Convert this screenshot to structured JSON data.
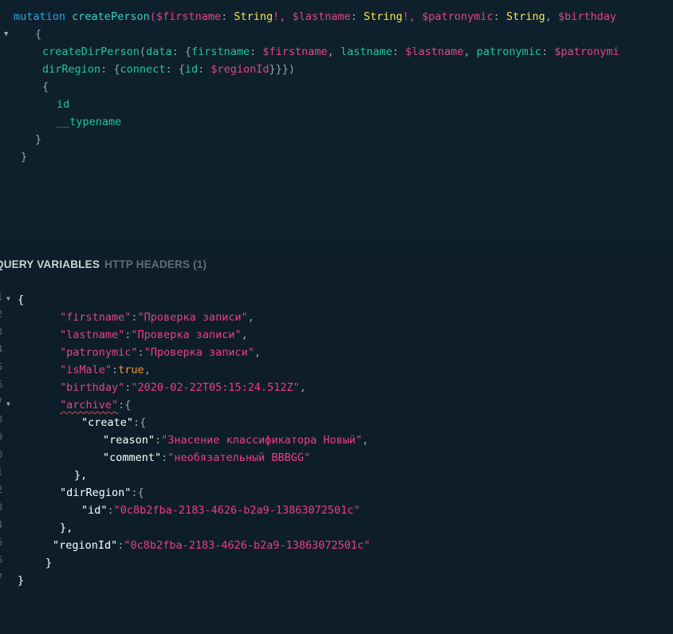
{
  "query_editor": {
    "lines": [
      [
        "mutation",
        "createPerson",
        "($firstname",
        ": ",
        "String",
        "!, ",
        "$lastname",
        ": ",
        "String",
        "!, ",
        "$patronymic",
        ": ",
        "String",
        ", ",
        "$birthday"
      ],
      [
        "{"
      ],
      [
        "createDirPerson",
        "(",
        "data",
        ": {",
        "firstname",
        ": ",
        "$firstname",
        ", ",
        "lastname",
        ": ",
        "$lastname",
        ", ",
        "patronymic",
        ": ",
        "$patronymi"
      ],
      [
        "dirRegion",
        ": {",
        "connect",
        ": {",
        "id",
        ": ",
        "$regionId",
        "}}})"
      ],
      [
        "{"
      ],
      [
        "id"
      ],
      [
        "__typename"
      ],
      [
        "}"
      ],
      [
        "}"
      ]
    ]
  },
  "tabs": {
    "query_variables": "QUERY VARIABLES",
    "http_headers": "HTTP HEADERS (1)"
  },
  "variables_editor": {
    "gutter": [
      "1",
      "2",
      "3",
      "4",
      "5",
      "6",
      "7",
      "8",
      "9",
      "0",
      "1",
      "2",
      "3",
      "4",
      "5",
      "6",
      "7"
    ],
    "firstname_key": "\"firstname\"",
    "firstname_val": "\"Проверка записи\"",
    "lastname_key": "\"lastname\"",
    "lastname_val": "\"Проверка записи\"",
    "patronymic_key": "\"patronymic\"",
    "patronymic_val": "\"Проверка записи\"",
    "isMale_key": "\"isMale\"",
    "isMale_val": "true",
    "birthday_key": "\"birthday\"",
    "birthday_val": "\"2020-02-22T05:15:24.512Z\"",
    "archive_key": "\"archive\"",
    "create_key": "\"create\"",
    "reason_key": "\"reason\"",
    "reason_val": "\"Знасение классификатора Новый\"",
    "comment_key": "\"comment\"",
    "comment_val": "\"необязательный BBBGG\"",
    "dirRegion_key": "\"dirRegion\"",
    "id_key": "\"id\"",
    "id_val": "\"0c8b2fba-2183-4626-b2a9-13863072501c\"",
    "regionId_key": "\"regionId\"",
    "regionId_val": "\"0c8b2fba-2183-4626-b2a9-13863072501c\""
  }
}
